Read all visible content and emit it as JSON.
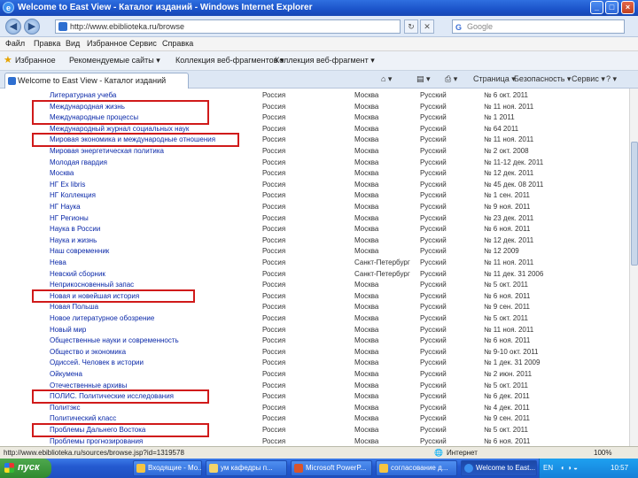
{
  "window": {
    "title": "Welcome to East View - Каталог изданий - Windows Internet Explorer",
    "minimize": "_",
    "maximize": "□",
    "close": "×"
  },
  "address": {
    "url": "http://www.ebiblioteka.ru/browse",
    "search_placeholder": "Google"
  },
  "menu": [
    "Файл",
    "Правка",
    "Вид",
    "Избранное",
    "Сервис",
    "Справка"
  ],
  "favorites": {
    "label": "Избранное",
    "items": [
      "Рекомендуемые сайты ▾",
      "Коллекция веб-фрагментов ▾",
      "Коллекция веб-фрагмент ▾"
    ]
  },
  "tab": {
    "label": "Welcome to East View - Каталог изданий",
    "tools": [
      "Страница ▾",
      "Безопасность ▾",
      "Сервис ▾"
    ]
  },
  "table": {
    "rows": [
      [
        "Литературная учеба",
        "Россия",
        "Москва",
        "Русский",
        "№ 6 окт. 2011"
      ],
      [
        "Международная жизнь",
        "Россия",
        "Москва",
        "Русский",
        "№ 11 ноя. 2011"
      ],
      [
        "Международные процессы",
        "Россия",
        "Москва",
        "Русский",
        "№ 1 2011"
      ],
      [
        "Международный журнал социальных наук",
        "Россия",
        "Москва",
        "Русский",
        "№ 64 2011"
      ],
      [
        "Мировая экономика и международные отношения",
        "Россия",
        "Москва",
        "Русский",
        "№ 11 ноя. 2011"
      ],
      [
        "Мировая энергетическая политика",
        "Россия",
        "Москва",
        "Русский",
        "№ 2 окт. 2008"
      ],
      [
        "Молодая гвардия",
        "Россия",
        "Москва",
        "Русский",
        "№ 11-12 дек. 2011"
      ],
      [
        "Москва",
        "Россия",
        "Москва",
        "Русский",
        "№ 12 дек. 2011"
      ],
      [
        "НГ Ex libris",
        "Россия",
        "Москва",
        "Русский",
        "№ 45 дек. 08 2011"
      ],
      [
        "НГ Коллекция",
        "Россия",
        "Москва",
        "Русский",
        "№ 1 сен. 2011"
      ],
      [
        "НГ Наука",
        "Россия",
        "Москва",
        "Русский",
        "№ 9 ноя. 2011"
      ],
      [
        "НГ Регионы",
        "Россия",
        "Москва",
        "Русский",
        "№ 23 дек. 2011"
      ],
      [
        "Наука в России",
        "Россия",
        "Москва",
        "Русский",
        "№ 6 ноя. 2011"
      ],
      [
        "Наука и жизнь",
        "Россия",
        "Москва",
        "Русский",
        "№ 12 дек. 2011"
      ],
      [
        "Наш современник",
        "Россия",
        "Москва",
        "Русский",
        "№ 12 2009"
      ],
      [
        "Нева",
        "Россия",
        "Санкт-Петербург",
        "Русский",
        "№ 11 ноя. 2011"
      ],
      [
        "Невский сборник",
        "Россия",
        "Санкт-Петербург",
        "Русский",
        "№ 11 дек. 31 2006"
      ],
      [
        "Неприкосновенный запас",
        "Россия",
        "Москва",
        "Русский",
        "№ 5 окт. 2011"
      ],
      [
        "Новая и новейшая история",
        "Россия",
        "Москва",
        "Русский",
        "№ 6 ноя. 2011"
      ],
      [
        "Новая Польша",
        "Россия",
        "Москва",
        "Русский",
        "№ 9 сен. 2011"
      ],
      [
        "Новое литературное обозрение",
        "Россия",
        "Москва",
        "Русский",
        "№ 5 окт. 2011"
      ],
      [
        "Новый мир",
        "Россия",
        "Москва",
        "Русский",
        "№ 11 ноя. 2011"
      ],
      [
        "Общественные науки и современность",
        "Россия",
        "Москва",
        "Русский",
        "№ 6 ноя. 2011"
      ],
      [
        "Общество и экономика",
        "Россия",
        "Москва",
        "Русский",
        "№ 9-10 окт. 2011"
      ],
      [
        "Одиссей. Человек в истории",
        "Россия",
        "Москва",
        "Русский",
        "№ 1 дек. 31 2009"
      ],
      [
        "Ойкумена",
        "Россия",
        "Москва",
        "Русский",
        "№ 2 июн. 2011"
      ],
      [
        "Отечественные архивы",
        "Россия",
        "Москва",
        "Русский",
        "№ 5 окт. 2011"
      ],
      [
        "ПОЛИС. Политические исследования",
        "Россия",
        "Москва",
        "Русский",
        "№ 6 дек. 2011"
      ],
      [
        "Политэкс",
        "Россия",
        "Москва",
        "Русский",
        "№ 4 дек. 2011"
      ],
      [
        "Политический класс",
        "Россия",
        "Москва",
        "Русский",
        "№ 9 сен. 2011"
      ],
      [
        "Проблемы Дальнего Востока",
        "Россия",
        "Москва",
        "Русский",
        "№ 5 окт. 2011"
      ],
      [
        "Проблемы прогнозирования",
        "Россия",
        "Москва",
        "Русский",
        "№ 6 ноя. 2011"
      ]
    ]
  },
  "status": {
    "url": "http://www.ebiblioteka.ru/sources/browse.jsp?id=1319578",
    "zone": "Интернет",
    "zoom": "100%"
  },
  "taskbar": {
    "start": "пуск",
    "buttons": [
      "Входящие - Mo...",
      "ум кафедры п...",
      "Microsoft PowerP...",
      "согласование д...",
      "Welcome to East..."
    ],
    "lang": "EN",
    "clock": "10:57"
  },
  "colors": {
    "highlight": "#d01a1a",
    "link": "#0a28a8"
  }
}
